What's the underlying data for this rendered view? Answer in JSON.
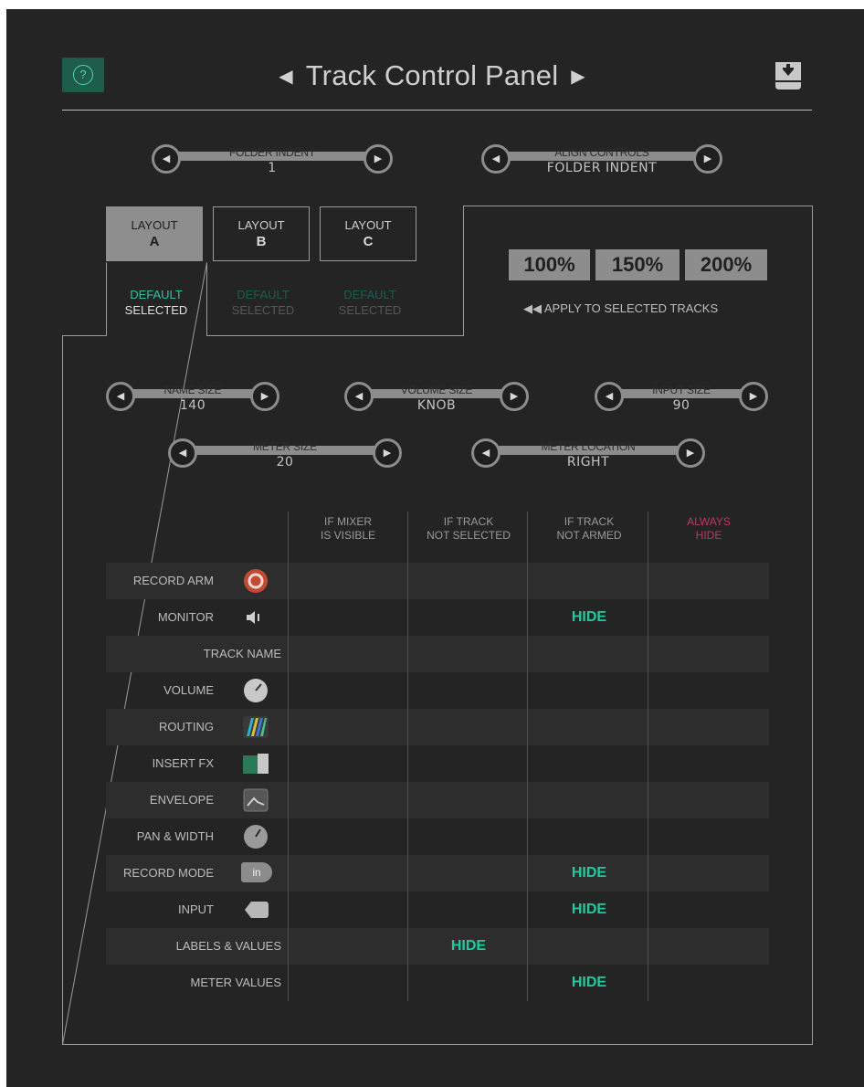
{
  "header": {
    "title": "Track Control Panel",
    "help_symbol": "?",
    "prev_arrow": "◀",
    "next_arrow": "▶",
    "help_icon": "question-circle-icon",
    "save_icon": "download-icon"
  },
  "top_controls": {
    "folder_indent": {
      "label": "FOLDER INDENT",
      "value": "1"
    },
    "align_controls": {
      "label": "ALIGN CONTROLS",
      "value": "FOLDER INDENT"
    }
  },
  "layouts": [
    {
      "label": "LAYOUT",
      "letter": "A",
      "default_label": "DEFAULT",
      "selected_label": "SELECTED"
    },
    {
      "label": "LAYOUT",
      "letter": "B",
      "default_label": "DEFAULT",
      "selected_label": "SELECTED"
    },
    {
      "label": "LAYOUT",
      "letter": "C",
      "default_label": "DEFAULT",
      "selected_label": "SELECTED"
    }
  ],
  "active_layout": "A",
  "sizes": [
    "100%",
    "150%",
    "200%"
  ],
  "apply_text": "◀◀  APPLY TO SELECTED TRACKS",
  "size_controls": {
    "name_size": {
      "label": "NAME SIZE",
      "value": "140"
    },
    "volume_size": {
      "label": "VOLUME SIZE",
      "value": "KNOB"
    },
    "input_size": {
      "label": "INPUT SIZE",
      "value": "90"
    },
    "meter_size": {
      "label": "METER SIZE",
      "value": "20"
    },
    "meter_location": {
      "label": "METER LOCATION",
      "value": "RIGHT"
    }
  },
  "columns": [
    {
      "line1": "IF MIXER",
      "line2": "IS VISIBLE"
    },
    {
      "line1": "IF TRACK",
      "line2": "NOT SELECTED"
    },
    {
      "line1": "IF TRACK",
      "line2": "NOT ARMED"
    },
    {
      "line1": "ALWAYS",
      "line2": "HIDE"
    }
  ],
  "hide_label": "HIDE",
  "rows": [
    {
      "name": "RECORD ARM",
      "icon": "record-arm-icon",
      "hide_col": null
    },
    {
      "name": "MONITOR",
      "icon": "speaker-icon",
      "hide_col": 3
    },
    {
      "name": "TRACK NAME",
      "icon": null,
      "hide_col": null
    },
    {
      "name": "VOLUME",
      "icon": "volume-knob-icon",
      "hide_col": null
    },
    {
      "name": "ROUTING",
      "icon": "routing-icon",
      "hide_col": null
    },
    {
      "name": "INSERT FX",
      "icon": "insert-fx-icon",
      "hide_col": null
    },
    {
      "name": "ENVELOPE",
      "icon": "envelope-icon",
      "hide_col": null
    },
    {
      "name": "PAN & WIDTH",
      "icon": "pan-knob-icon",
      "hide_col": null
    },
    {
      "name": "RECORD MODE",
      "icon": "record-mode-icon",
      "icon_text": "in",
      "hide_col": 3
    },
    {
      "name": "INPUT",
      "icon": "input-icon",
      "hide_col": 3
    },
    {
      "name": "LABELS & VALUES",
      "icon": null,
      "hide_col": 2
    },
    {
      "name": "METER VALUES",
      "icon": null,
      "hide_col": 3
    }
  ],
  "colors": {
    "accent": "#23c8a0",
    "always_hide": "#c4336a",
    "background": "#242424"
  }
}
